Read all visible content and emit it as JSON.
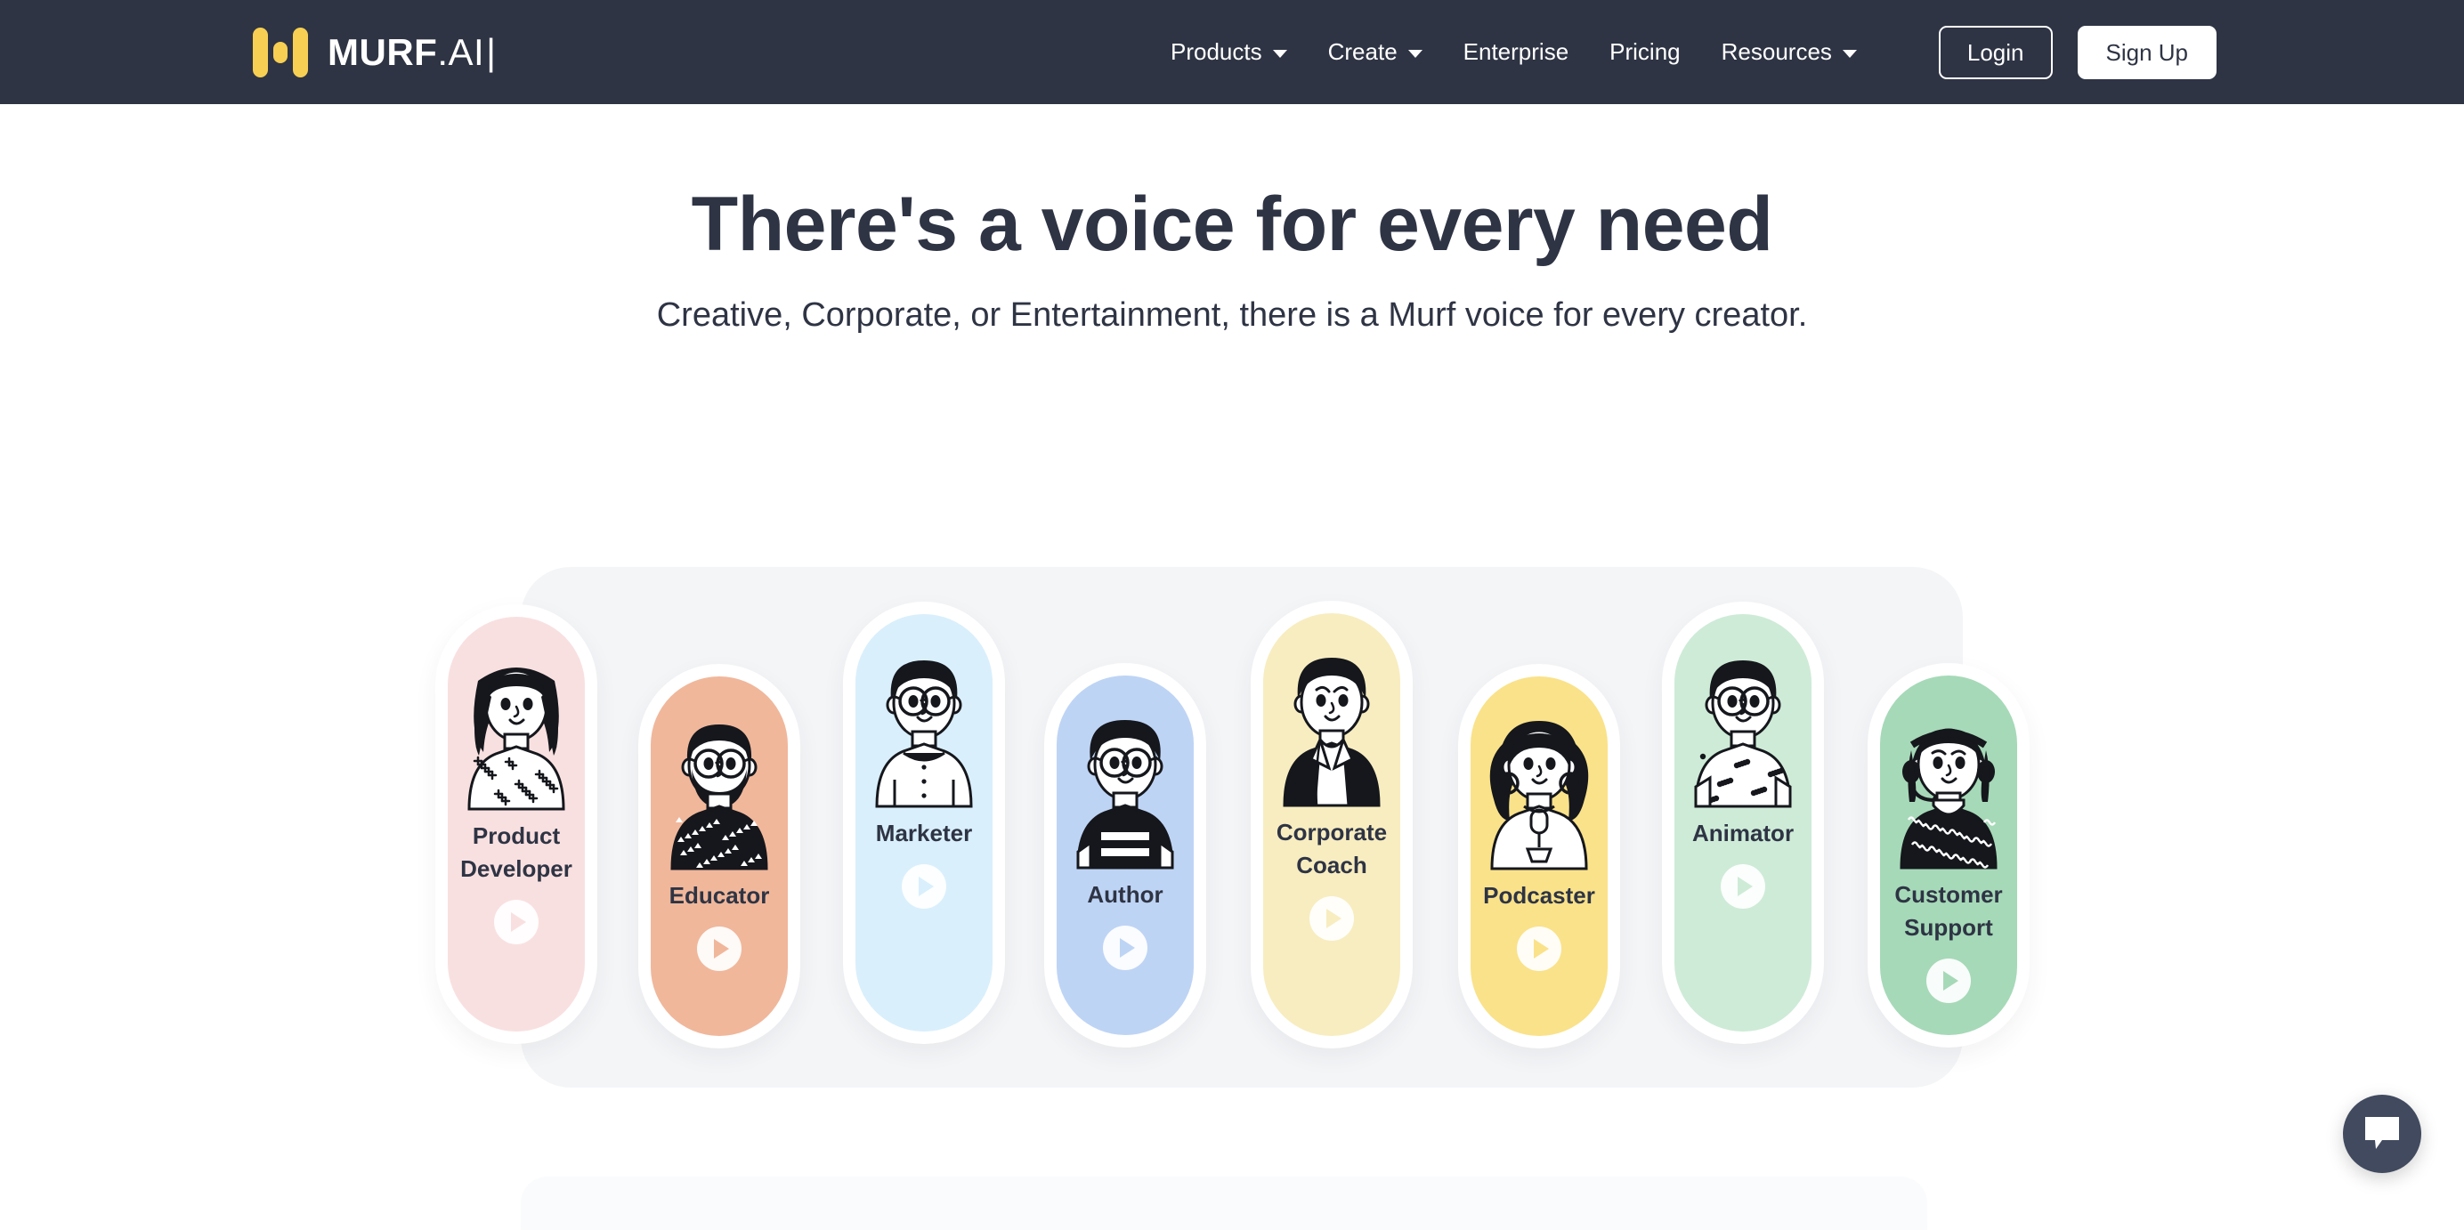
{
  "navbar": {
    "brand": {
      "strong": "MURF",
      "light": ".AI",
      "caret": "|",
      "icon": "murf-logo-icon"
    },
    "links": [
      {
        "label": "Products",
        "has_chevron": true,
        "name": "products"
      },
      {
        "label": "Create",
        "has_chevron": true,
        "name": "create"
      },
      {
        "label": "Enterprise",
        "has_chevron": false,
        "name": "enterprise"
      },
      {
        "label": "Pricing",
        "has_chevron": false,
        "name": "pricing"
      },
      {
        "label": "Resources",
        "has_chevron": true,
        "name": "resources"
      }
    ],
    "login_label": "Login",
    "signup_label": "Sign Up",
    "background": "#2E3444",
    "accent": "#F7CF52"
  },
  "hero": {
    "title": "There's a voice for every need",
    "subtitle": "Creative, Corporate, or Entertainment, there is a Murf voice for every creator."
  },
  "voice_cards": {
    "panel_background": "#F4F5F7",
    "items": [
      {
        "label": "Product Developer",
        "color": "#F9E0E0",
        "avatar": "woman-long-hair-star-top-avatar",
        "play": "play-icon"
      },
      {
        "label": "Educator",
        "color": "#F0B79B",
        "avatar": "bearded-man-glasses-avatar",
        "play": "play-icon"
      },
      {
        "label": "Marketer",
        "color": "#D9EFFC",
        "avatar": "man-glasses-white-shirt-avatar",
        "play": "play-icon"
      },
      {
        "label": "Author",
        "color": "#BED4F5",
        "avatar": "man-glasses-striped-tee-avatar",
        "play": "play-icon"
      },
      {
        "label": "Corporate Coach",
        "color": "#F8EDC0",
        "avatar": "man-blazer-avatar",
        "play": "play-icon"
      },
      {
        "label": "Podcaster",
        "color": "#FAE28A",
        "avatar": "woman-curly-hair-microphone-avatar",
        "play": "play-icon"
      },
      {
        "label": "Animator",
        "color": "#CEEBD7",
        "avatar": "boy-glasses-dotted-tee-avatar",
        "play": "play-icon"
      },
      {
        "label": "Customer Support",
        "color": "#A6D9B8",
        "avatar": "woman-headset-avatar",
        "play": "play-icon"
      }
    ]
  },
  "chat_widget": {
    "icon": "chat-bubble-icon",
    "color": "#414A5F"
  }
}
